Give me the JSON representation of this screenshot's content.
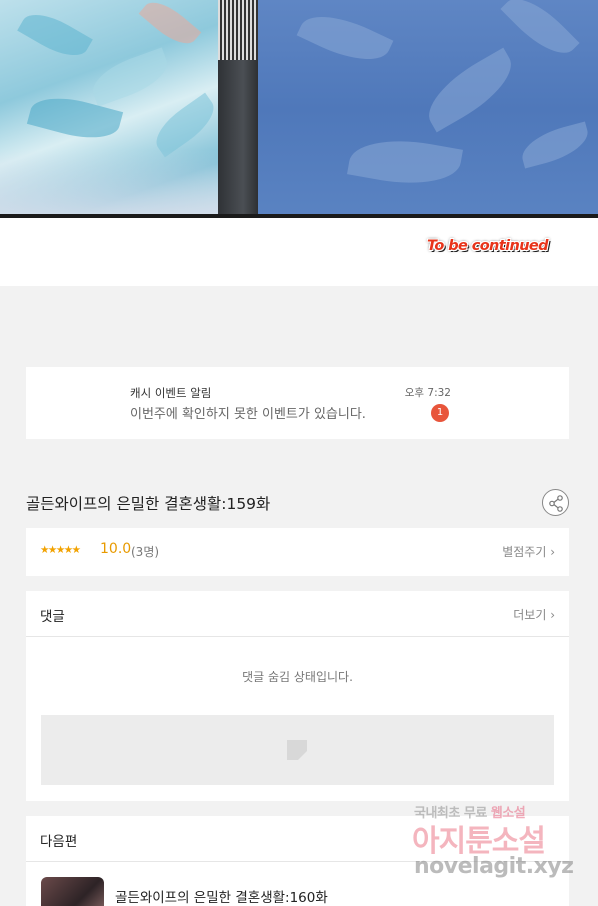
{
  "comic": {
    "caption": "To be continued"
  },
  "notification": {
    "title": "캐시 이벤트 알림",
    "message": "이번주에 확인하지 못한 이벤트가 있습니다.",
    "time": "오후 7:32",
    "badge_count": "1"
  },
  "episode": {
    "title": "골든와이프의 은밀한 결혼생활:159화",
    "share_icon": "share-icon"
  },
  "rating": {
    "stars": "★★★★★",
    "score": "10.0",
    "votes": "(3명)",
    "rate_label": "별점주기 ›",
    "star_color": "#f2a200"
  },
  "comments": {
    "header": "댓글",
    "more_label": "더보기 ›",
    "hidden_message": "댓글 숨김 상태입니다."
  },
  "next_episode": {
    "header": "다음편",
    "title": "골든와이프의 은밀한 결혼생활:160화"
  },
  "watermark": {
    "line1_a": "국내최초 무료 ",
    "line1_b": "웹소설",
    "line2": "아지툰소설",
    "line3": "novelagit.xyz"
  }
}
